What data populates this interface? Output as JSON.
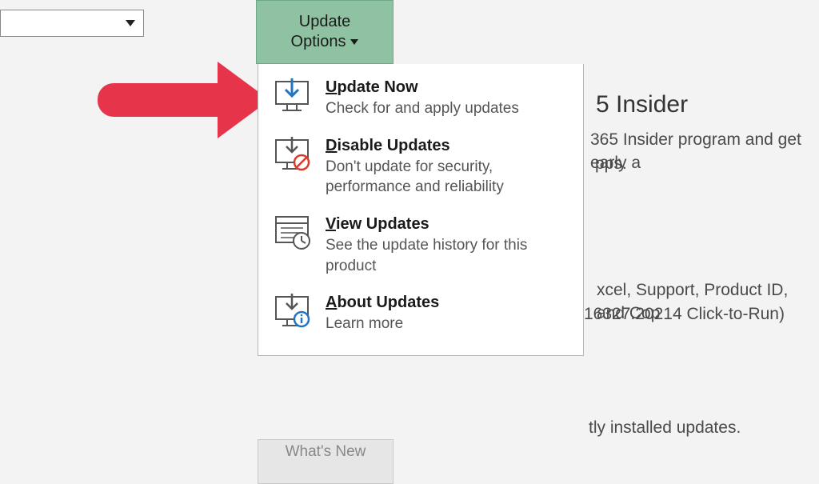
{
  "top_dropdown": {
    "value": ""
  },
  "update_options_button": {
    "line1": "Update",
    "line2": "Options"
  },
  "menu": [
    {
      "title_pre": "",
      "title_u": "U",
      "title_post": "pdate Now",
      "desc": "Check for and apply updates"
    },
    {
      "title_pre": "",
      "title_u": "D",
      "title_post": "isable Updates",
      "desc": "Don't update for security, performance and reliability"
    },
    {
      "title_pre": "",
      "title_u": "V",
      "title_post": "iew Updates",
      "desc": "See the update history for this product"
    },
    {
      "title_pre": "",
      "title_u": "A",
      "title_post": "bout Updates",
      "desc": "Learn more"
    }
  ],
  "background": {
    "insider_heading": "5 Insider",
    "insider_line1": "365 Insider program and get early a",
    "insider_line2": "pps.",
    "about_line1": "xcel, Support, Product ID, and Cop",
    "about_line2": " 16327.20214 Click-to-Run)",
    "updates_line": "tly installed updates."
  },
  "whats_new_label": "What's New"
}
